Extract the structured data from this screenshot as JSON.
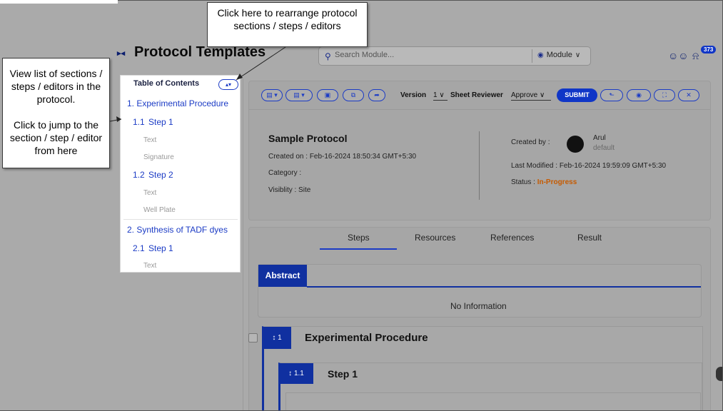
{
  "header": {
    "title": "Protocol Templates",
    "search_placeholder": "Search Module...",
    "module_label": "Module",
    "notification_count": "373"
  },
  "toc": {
    "title": "Table of Contents",
    "items": [
      {
        "label": "1.  Experimental Procedure"
      },
      {
        "num": "1.1",
        "label": "Step 1"
      },
      {
        "label": "Text"
      },
      {
        "label": "Signature"
      },
      {
        "num": "1.2",
        "label": "Step 2"
      },
      {
        "label": "Text"
      },
      {
        "label": "Well Plate"
      },
      {
        "label": "2. Synthesis of TADF dyes"
      },
      {
        "num": "2.1",
        "label": "Step 1"
      },
      {
        "label": "Text"
      }
    ]
  },
  "callouts": {
    "reorder": "Click here to rearrange protocol sections / steps / editors",
    "toc_help_1": "View list of sections / steps / editors in the protocol.",
    "toc_help_2": "Click to jump to the section / step / editor from here"
  },
  "toolbar": {
    "version_label": "Version",
    "version_value": "1",
    "sheet_reviewer_label": "Sheet Reviewer",
    "reviewer_action": "Approve",
    "submit_label": "SUBMIT"
  },
  "protocol": {
    "name": "Sample Protocol",
    "created_on": "Created on : Feb-16-2024 18:50:34 GMT+5:30",
    "category": "Category :",
    "visibility": "Visiblity : Site",
    "created_by_label": "Created by :",
    "creator_name": "Arul",
    "creator_role": "default",
    "last_modified": "Last Modified : Feb-16-2024 19:59:09 GMT+5:30",
    "status_label": "Status : ",
    "status_value": "In-Progress"
  },
  "tabs": [
    "Steps",
    "Resources",
    "References",
    "Result"
  ],
  "abstract": {
    "tab_label": "Abstract",
    "content": "No Information"
  },
  "sections": [
    {
      "num": "1",
      "title": "Experimental Procedure",
      "steps": [
        {
          "num": "1.1",
          "title": "Step 1"
        }
      ]
    }
  ],
  "colors": {
    "accent": "#1036c7",
    "status": "#c65a00"
  }
}
